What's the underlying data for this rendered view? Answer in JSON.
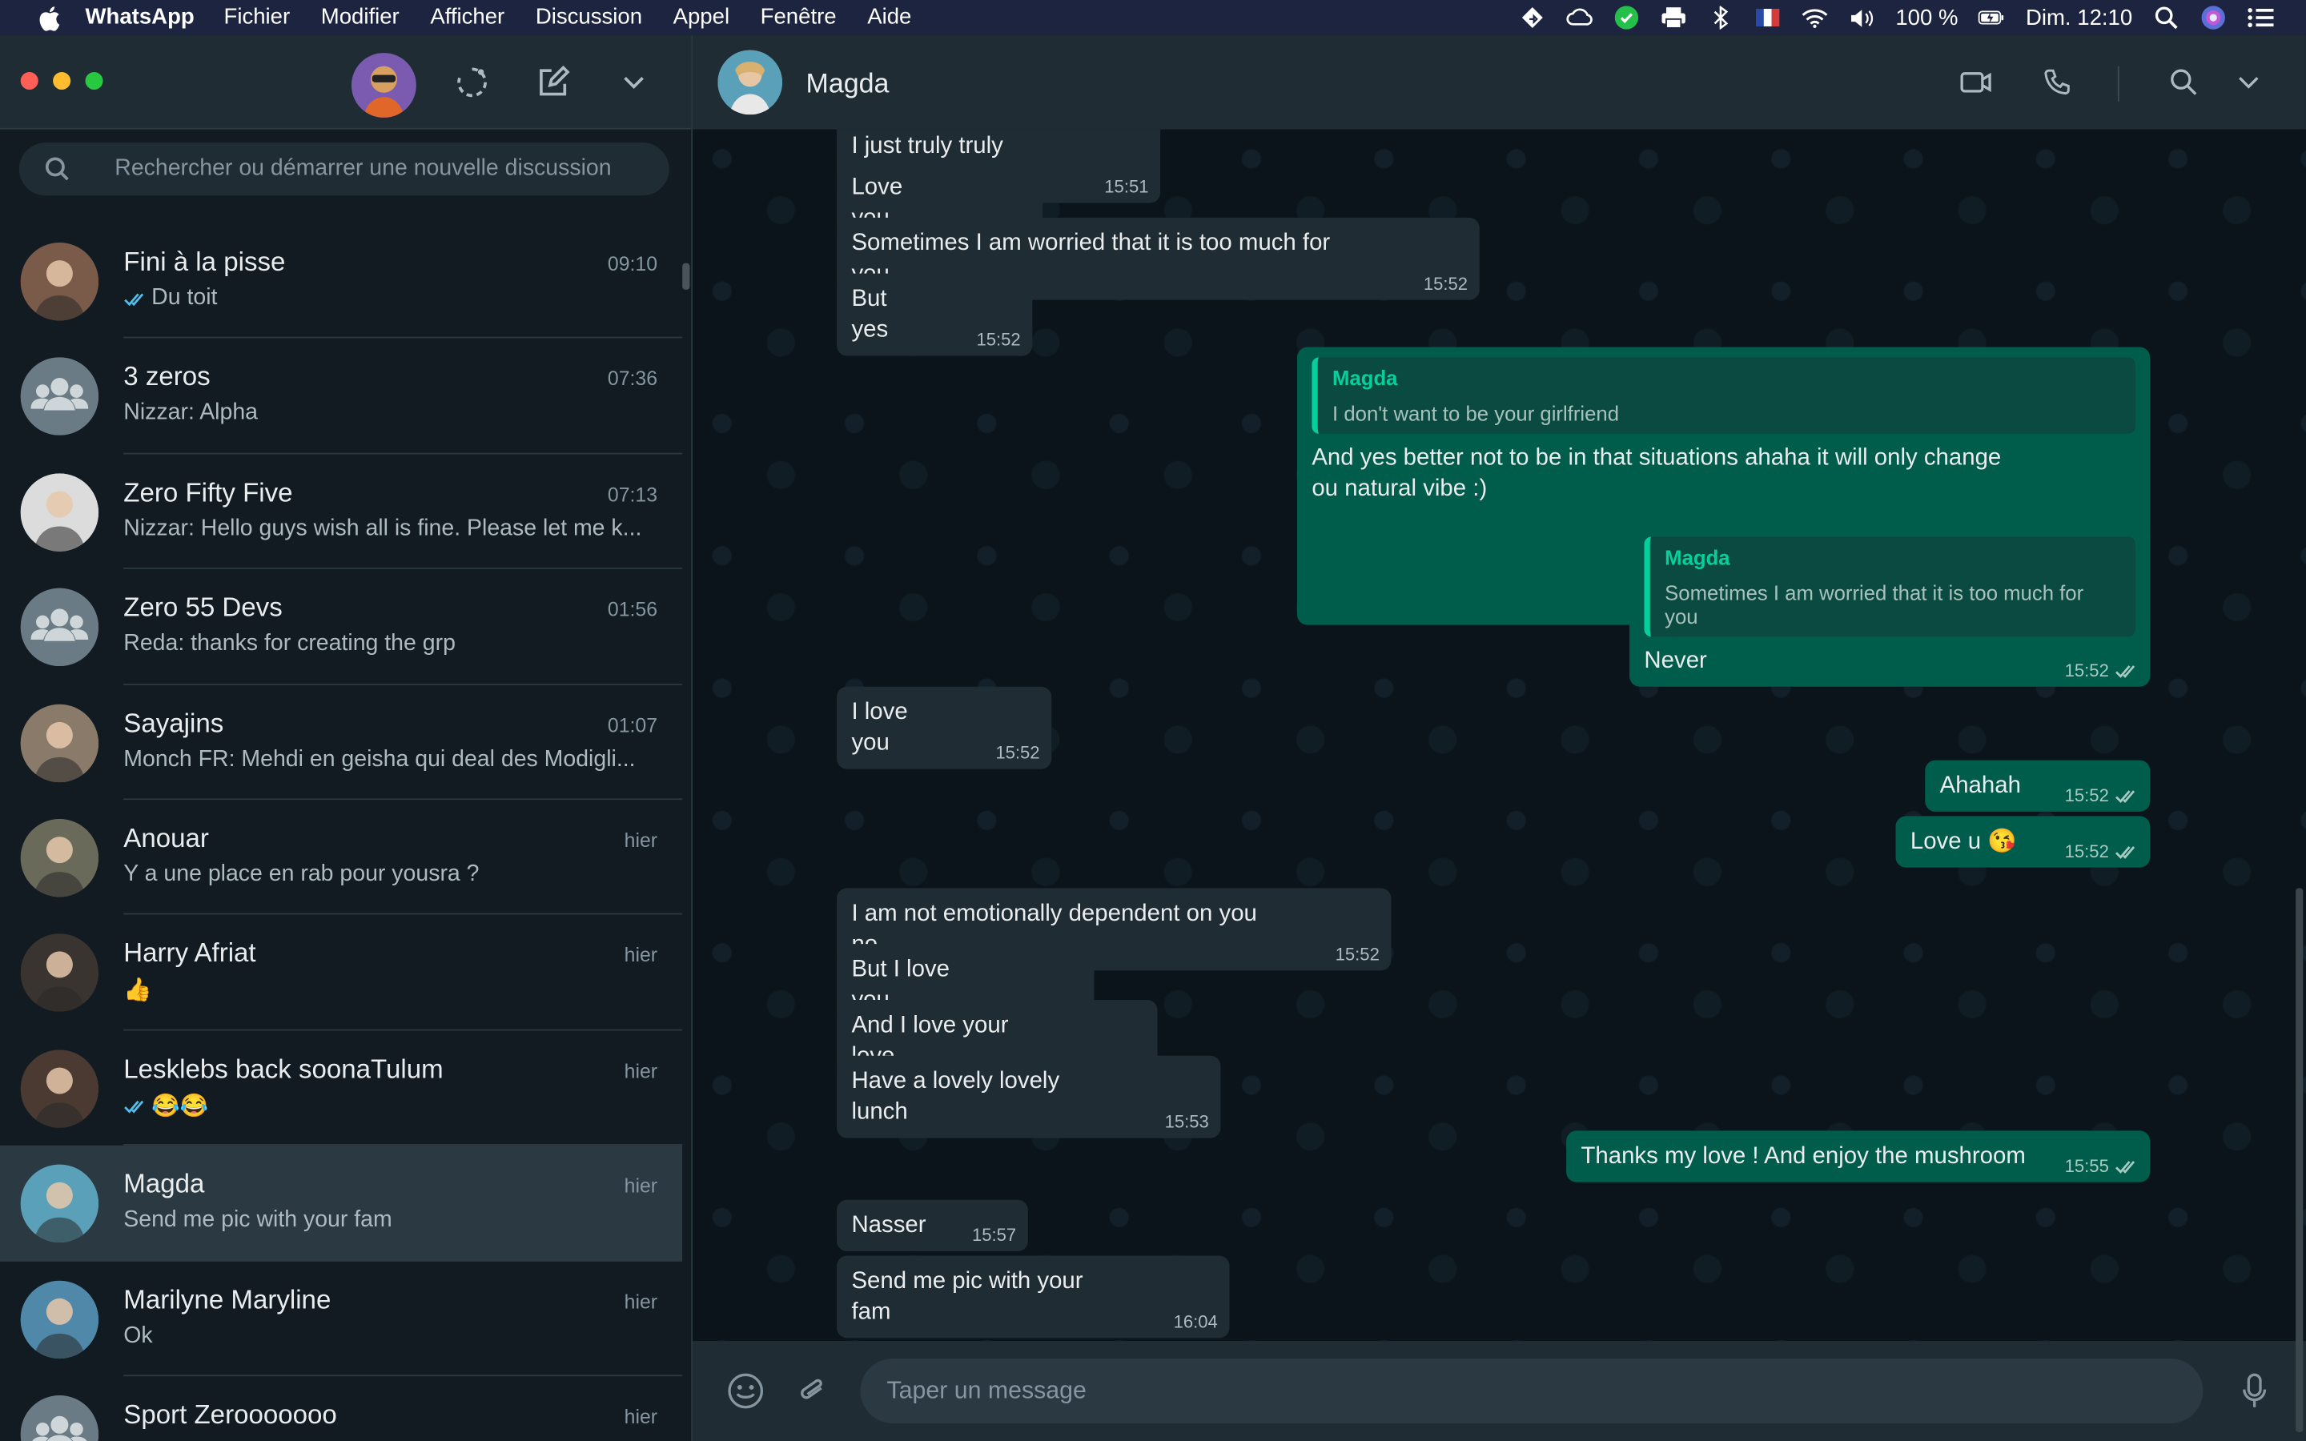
{
  "menubar": {
    "app": "WhatsApp",
    "items": [
      "Fichier",
      "Modifier",
      "Afficher",
      "Discussion",
      "Appel",
      "Fenêtre",
      "Aide"
    ],
    "battery": "100 %",
    "clock": "Dim. 12:10"
  },
  "sidebar": {
    "search_placeholder": "Rechercher ou démarrer une nouvelle discussion",
    "chats": [
      {
        "name": "Fini à la pisse",
        "time": "09:10",
        "preview": "Du toit",
        "ticks": true,
        "avatar_color": "#7a5a48",
        "group": false
      },
      {
        "name": "3 zeros",
        "time": "07:36",
        "preview": "Nizzar: Alpha",
        "ticks": false,
        "avatar_color": "#6b7b85",
        "group": true
      },
      {
        "name": "Zero Fifty Five",
        "time": "07:13",
        "preview": "Nizzar: Hello guys wish all is fine. Please let me k...",
        "ticks": false,
        "avatar_color": "#dcdcdc",
        "group": false
      },
      {
        "name": "Zero 55 Devs",
        "time": "01:56",
        "preview": "Reda: thanks for creating the grp",
        "ticks": false,
        "avatar_color": "#6b7b85",
        "group": true
      },
      {
        "name": "Sayajins",
        "time": "01:07",
        "preview": "Monch FR: Mehdi en geisha qui deal des Modigli...",
        "ticks": false,
        "avatar_color": "#8a7a6a",
        "group": false
      },
      {
        "name": "Anouar",
        "time": "hier",
        "preview": "Y a une place en rab pour yousra ?",
        "ticks": false,
        "avatar_color": "#6a6a5a",
        "group": false
      },
      {
        "name": "Harry Afriat",
        "time": "hier",
        "preview": "👍",
        "ticks": false,
        "avatar_color": "#3a3430",
        "group": false
      },
      {
        "name": "Lesklebs back soonaTulum",
        "time": "hier",
        "preview": "😂😂",
        "ticks": true,
        "avatar_color": "#4a3a32",
        "group": false
      },
      {
        "name": "Magda",
        "time": "hier",
        "preview": "Send me pic with your fam",
        "ticks": false,
        "avatar_color": "#5aa0b8",
        "group": false,
        "active": true
      },
      {
        "name": "Marilyne Maryline",
        "time": "hier",
        "preview": "Ok",
        "ticks": false,
        "avatar_color": "#4f88a8",
        "group": false
      },
      {
        "name": "Sport Zerooooooo",
        "time": "hier",
        "preview": "",
        "ticks": false,
        "avatar_color": "#6b7b85",
        "group": true
      }
    ]
  },
  "conversation": {
    "title": "Magda",
    "composer_placeholder": "Taper un message",
    "messages": [
      {
        "dir": "in",
        "text": "I just truly truly truly",
        "time": "15:51"
      },
      {
        "dir": "in",
        "text": "Love you",
        "time": "15:51"
      },
      {
        "dir": "in",
        "text": "Sometimes I am worried that it is too much for you",
        "time": "15:52"
      },
      {
        "dir": "in",
        "text": "But yes",
        "time": "15:52"
      },
      {
        "dir": "out",
        "quote_name": "Magda",
        "quote_text": "I don't want to be your girlfriend",
        "text": "And yes better not to be in that situations ahaha it will only change ou natural vibe :)",
        "time": "15:52"
      },
      {
        "dir": "out",
        "quote_name": "Magda",
        "quote_text": "Sometimes I am worried that it is too much for you",
        "text": "Never",
        "time": "15:52"
      },
      {
        "dir": "in",
        "text": "I love you",
        "time": "15:52"
      },
      {
        "dir": "out",
        "text": "Ahahah",
        "time": "15:52"
      },
      {
        "dir": "out",
        "text": "Love u 😘",
        "time": "15:52"
      },
      {
        "dir": "in",
        "text": "I am not emotionally dependent on you no",
        "time": "15:52"
      },
      {
        "dir": "in",
        "text": "But I love you",
        "time": "15:52"
      },
      {
        "dir": "in",
        "text": "And I love your love",
        "time": "15:52"
      },
      {
        "dir": "in",
        "text": "Have a lovely lovely lunch",
        "time": "15:53"
      },
      {
        "dir": "out",
        "text": "Thanks my love ! And enjoy the mushroom",
        "time": "15:55"
      },
      {
        "dir": "in",
        "text": "Nasser",
        "time": "15:57"
      },
      {
        "dir": "in",
        "text": "Send me pic with your fam",
        "time": "16:04"
      }
    ]
  },
  "colors": {
    "bubble_out": "#005c4b",
    "bubble_in": "#202c33",
    "accent": "#06cf9c",
    "tick_blue": "#53bdeb"
  }
}
